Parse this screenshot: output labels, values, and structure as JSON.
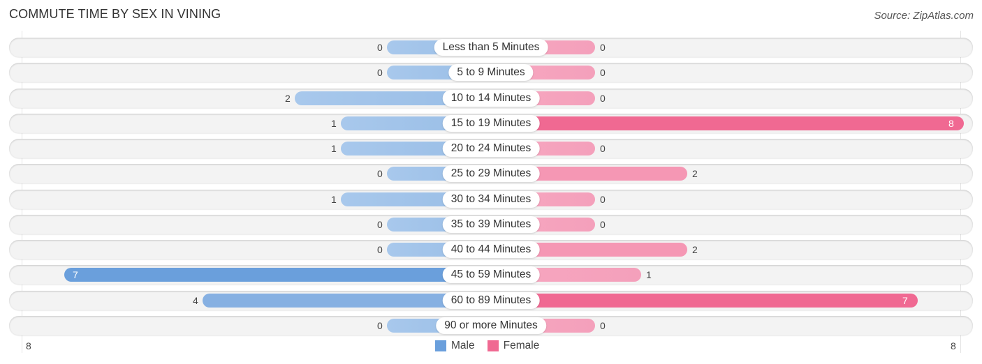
{
  "header": {
    "title": "COMMUTE TIME BY SEX IN VINING",
    "source": "Source: ZipAtlas.com"
  },
  "colors": {
    "male": "#6a9fdc",
    "male_light": "#a4c5ea",
    "female": "#f06992",
    "female_light": "#f6a5bf",
    "row_bg": "#f3f3f3"
  },
  "chart_data": {
    "type": "bar",
    "orientation": "horizontal-diverging",
    "title": "COMMUTE TIME BY SEX IN VINING",
    "categories": [
      "Less than 5 Minutes",
      "5 to 9 Minutes",
      "10 to 14 Minutes",
      "15 to 19 Minutes",
      "20 to 24 Minutes",
      "25 to 29 Minutes",
      "30 to 34 Minutes",
      "35 to 39 Minutes",
      "40 to 44 Minutes",
      "45 to 59 Minutes",
      "60 to 89 Minutes",
      "90 or more Minutes"
    ],
    "series": [
      {
        "name": "Male",
        "values": [
          0,
          0,
          2,
          1,
          1,
          0,
          1,
          0,
          0,
          7,
          4,
          0
        ]
      },
      {
        "name": "Female",
        "values": [
          0,
          0,
          0,
          8,
          0,
          2,
          0,
          0,
          2,
          1,
          7,
          0
        ]
      }
    ],
    "axis": {
      "left_tick": "8",
      "right_tick": "8",
      "max": 8
    },
    "legend": {
      "position": "bottom-center",
      "entries": [
        "Male",
        "Female"
      ]
    },
    "grid": false
  }
}
